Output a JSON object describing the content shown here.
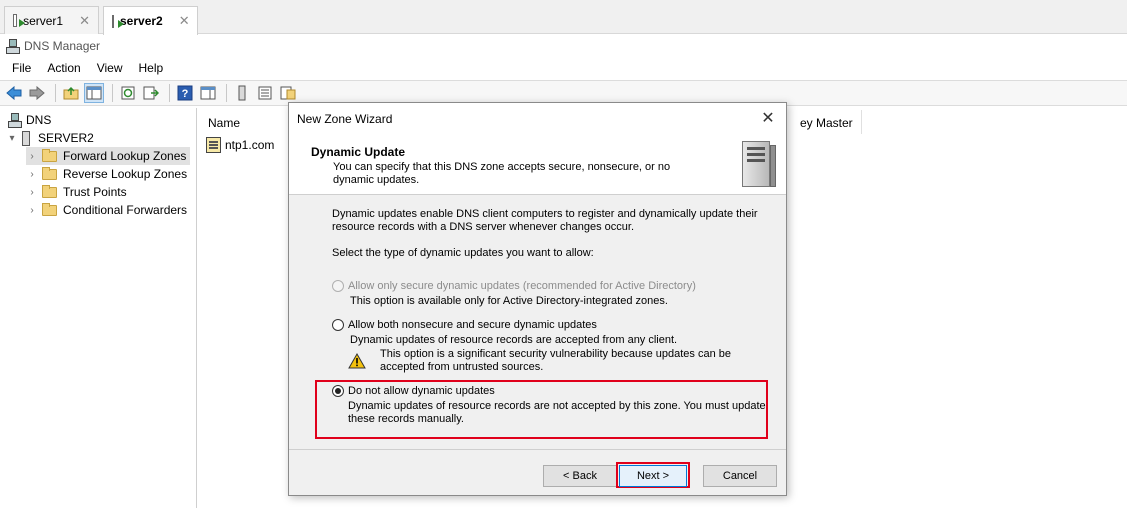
{
  "tabs": [
    {
      "label": "server1",
      "close": "✕"
    },
    {
      "label": "server2",
      "close": "✕"
    }
  ],
  "window": {
    "title": "DNS Manager"
  },
  "menu": [
    "File",
    "Action",
    "View",
    "Help"
  ],
  "tree": {
    "root": "DNS",
    "server": "SERVER2",
    "items": [
      "Forward Lookup Zones",
      "Reverse Lookup Zones",
      "Trust Points",
      "Conditional Forwarders"
    ]
  },
  "list": {
    "col_name": "Name",
    "col_key_master": "ey Master",
    "rows": [
      "ntp1.com"
    ]
  },
  "dialog": {
    "title": "New Zone Wizard",
    "header_title": "Dynamic Update",
    "header_desc": "You can specify that this DNS zone accepts secure, nonsecure, or no dynamic updates.",
    "intro": "Dynamic updates enable DNS client computers to register and dynamically update their resource records with a DNS server whenever changes occur.",
    "prompt": "Select the type of dynamic updates you want to allow:",
    "options": [
      {
        "label": "Allow only secure dynamic updates (recommended for Active Directory)",
        "desc": "This option is available only for Active Directory-integrated zones."
      },
      {
        "label": "Allow both nonsecure and secure dynamic updates",
        "desc": "Dynamic updates of resource records are accepted from any client."
      },
      {
        "label": "Do not allow dynamic updates",
        "desc": "Dynamic updates of resource records are not accepted by this zone. You must update these records manually."
      }
    ],
    "warning": "This option is a significant security vulnerability because updates can be accepted from untrusted sources.",
    "buttons": {
      "back": "< Back",
      "next": "Next >",
      "cancel": "Cancel"
    },
    "close": "✕"
  },
  "colors": {
    "highlight": "#e0001b",
    "accent": "#0078d7"
  }
}
